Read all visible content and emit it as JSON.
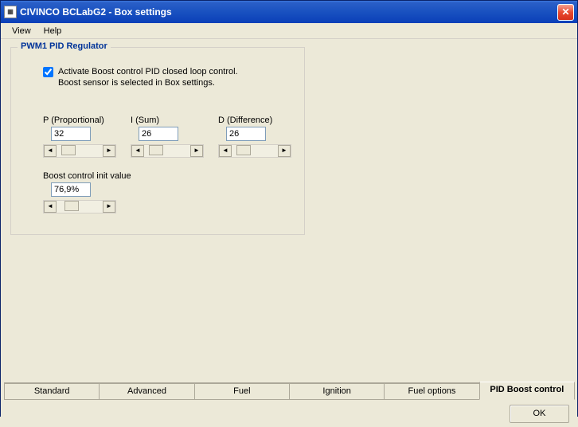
{
  "window": {
    "title": "CIVINCO  BCLabG2 - Box settings"
  },
  "menu": {
    "view": "View",
    "help": "Help"
  },
  "group": {
    "title": "PWM1 PID Regulator",
    "checkbox_line1": "Activate Boost control PID closed loop control.",
    "checkbox_line2": "Boost sensor is selected in Box settings.",
    "checkbox_checked": true,
    "p": {
      "label": "P (Proportional)",
      "value": "32"
    },
    "i": {
      "label": "I (Sum)",
      "value": "26"
    },
    "d": {
      "label": "D (Difference)",
      "value": "26"
    },
    "init": {
      "label": "Boost control init value",
      "value": "76,9%"
    }
  },
  "tabs": {
    "items": [
      {
        "label": "Standard",
        "active": false
      },
      {
        "label": "Advanced",
        "active": false
      },
      {
        "label": "Fuel",
        "active": false
      },
      {
        "label": "Ignition",
        "active": false
      },
      {
        "label": "Fuel options",
        "active": false
      },
      {
        "label": "PID Boost control",
        "active": true
      }
    ]
  },
  "buttons": {
    "ok": "OK"
  }
}
